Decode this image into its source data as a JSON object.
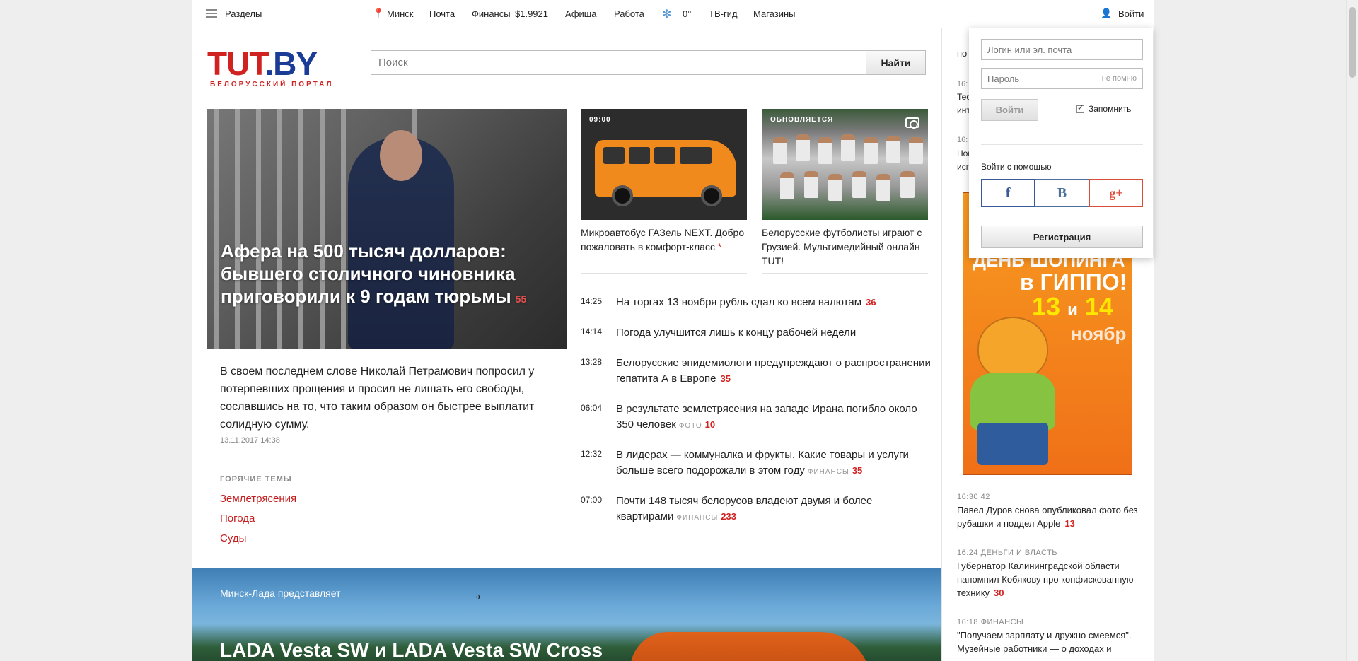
{
  "topnav": {
    "sections": "Разделы",
    "city": "Минск",
    "mail": "Почта",
    "finance": "Финансы",
    "usd_rate": "$1.9921",
    "afisha": "Афиша",
    "jobs": "Работа",
    "weather": "0°",
    "tv": "ТВ-гид",
    "shops": "Магазины",
    "login": "Войти"
  },
  "logo": {
    "text_red": "TUT",
    "text_blue": ".BY",
    "tagline": "БЕЛОРУССКИЙ ПОРТАЛ"
  },
  "search": {
    "placeholder": "Поиск",
    "button": "Найти"
  },
  "main_story": {
    "title": "Афера на 500 тысяч долларов: бывшего столичного чиновника приговорили к 9 годам тюрьмы",
    "comments": "55",
    "lead": "В своем последнем слове Николай Петрамович попросил у потерпевших прощения и просил не лишать его свободы, сославшись на то, что таким образом он быстрее выплатит солидную сумму.",
    "date": "13.11.2017 14:38"
  },
  "hot_topics": {
    "heading": "ГОРЯЧИЕ ТЕМЫ",
    "items": [
      "Землетрясения",
      "Погода",
      "Суды"
    ]
  },
  "thumbs": [
    {
      "label": "09:00",
      "caption": "Микроавтобус ГАЗель NEXT. Добро пожаловать в комфорт-класс",
      "mark": "*"
    },
    {
      "label": "ОБНОВЛЯЕТСЯ",
      "caption": "Белорусские футболисты играют с Грузией. Мультимедийный онлайн TUT!"
    }
  ],
  "news": [
    {
      "time": "14:25",
      "title": "На торгах 13 ноября рубль сдал ко всем валютам",
      "tag": "",
      "count": "36"
    },
    {
      "time": "14:14",
      "title": "Погода улучшится лишь к концу рабочей недели",
      "tag": "",
      "count": ""
    },
    {
      "time": "13:28",
      "title": "Белорусские эпидемиологи предупреждают о распространении гепатита А в Европе",
      "tag": "",
      "count": "35"
    },
    {
      "time": "06:04",
      "title": "В результате землетрясения на западе Ирана погибло около 350 человек",
      "tag": "ФОТО",
      "count": "10"
    },
    {
      "time": "12:32",
      "title": "В лидерах — коммуналка и фрукты. Какие товары и услуги больше всего подорожали в этом году",
      "tag": "ФИНАНСЫ",
      "count": "35"
    },
    {
      "time": "07:00",
      "title": "Почти 148 тысяч белорусов владеют двумя и более квартирами",
      "tag": "ФИНАНСЫ",
      "count": "233"
    }
  ],
  "right_col": {
    "partial_head": "по",
    "partial": [
      {
        "time": "16:",
        "line1": "Тес",
        "line2": "инт"
      },
      {
        "time": "16:",
        "line1": "Нов",
        "line2": "исп"
      }
    ],
    "items": [
      {
        "meta": "16:30 42",
        "text": "Павел Дуров снова опубликовал фото без рубашки и поддел Apple",
        "count": "13"
      },
      {
        "meta": "16:24 ДЕНЬГИ И ВЛАСТЬ",
        "text": "Губернатор Калининградской области напомнил Кобякову про конфискованную технику",
        "count": "30"
      },
      {
        "meta": "16:18 ФИНАНСЫ",
        "text": "\"Получаем зарплату и дружно смеемся\". Музейные работники — о доходах и",
        "count": ""
      }
    ]
  },
  "ad": {
    "line1": "ДЕНЬ ШОПИНГА",
    "line2": "в ГИППО!",
    "num1": "13",
    "and": "и",
    "num2": "14",
    "month": "ноябр"
  },
  "login_popup": {
    "login_placeholder": "Логин или эл. почта",
    "password_placeholder": "Пароль",
    "forgot": "не помню",
    "enter": "Войти",
    "remember": "Запомнить",
    "via": "Войти с помощью",
    "social": [
      "f",
      "B",
      "g+"
    ],
    "register": "Регистрация"
  },
  "promo": {
    "label": "Минск-Лада представляет",
    "title": "LADA Vesta SW и LADA Vesta SW Cross"
  }
}
